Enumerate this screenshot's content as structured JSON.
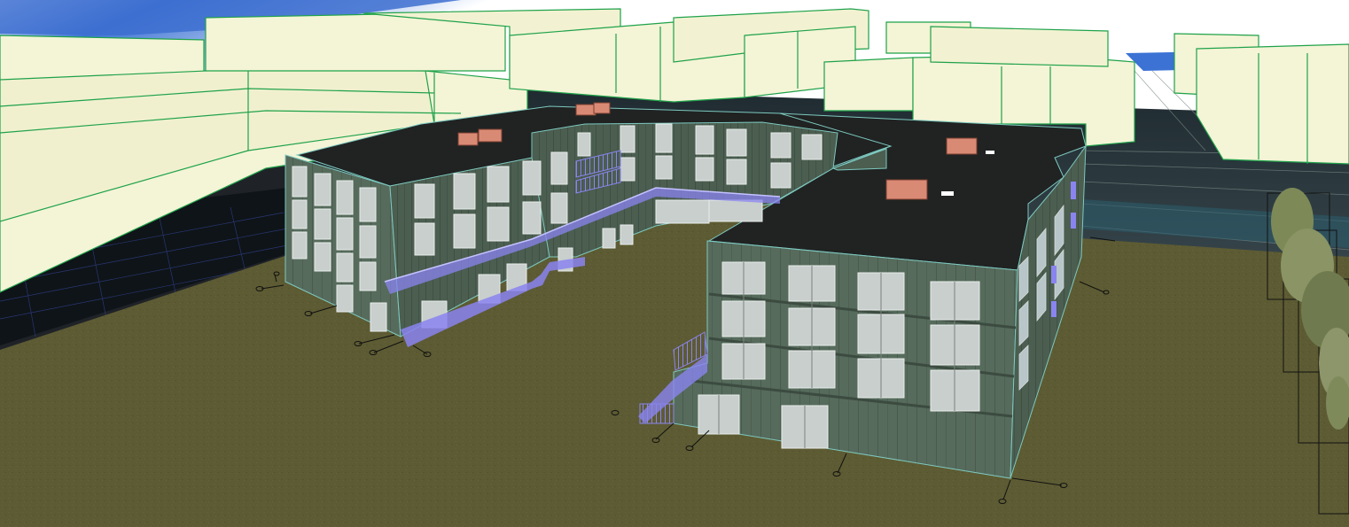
{
  "viewport": {
    "view": "3D",
    "projection": "perspective",
    "style": "shaded-with-edges"
  },
  "scene": {
    "sky_colors": [
      "#ffffff",
      "#3b72d4"
    ],
    "ground_color": "#5d5b33",
    "context_building_fill": "#f4f4d6",
    "context_building_edge": "#1fa24a",
    "facade_color": "#566b5c",
    "roof_color": "#202322",
    "glazing_color": "#c9cfcd",
    "railing_color": "#8a84f0",
    "rooftop_unit_color": "#d98a75",
    "tree_foliage_color": "#7d8a57"
  },
  "objects": {
    "main_building": {
      "kind": "building",
      "wings": [
        "west-wing",
        "center-wing",
        "east-wing"
      ],
      "storeys": 4
    },
    "context_buildings": {
      "kind": "massing"
    },
    "trees": {
      "kind": "vegetation"
    },
    "survey_points": {
      "kind": "markers"
    }
  }
}
